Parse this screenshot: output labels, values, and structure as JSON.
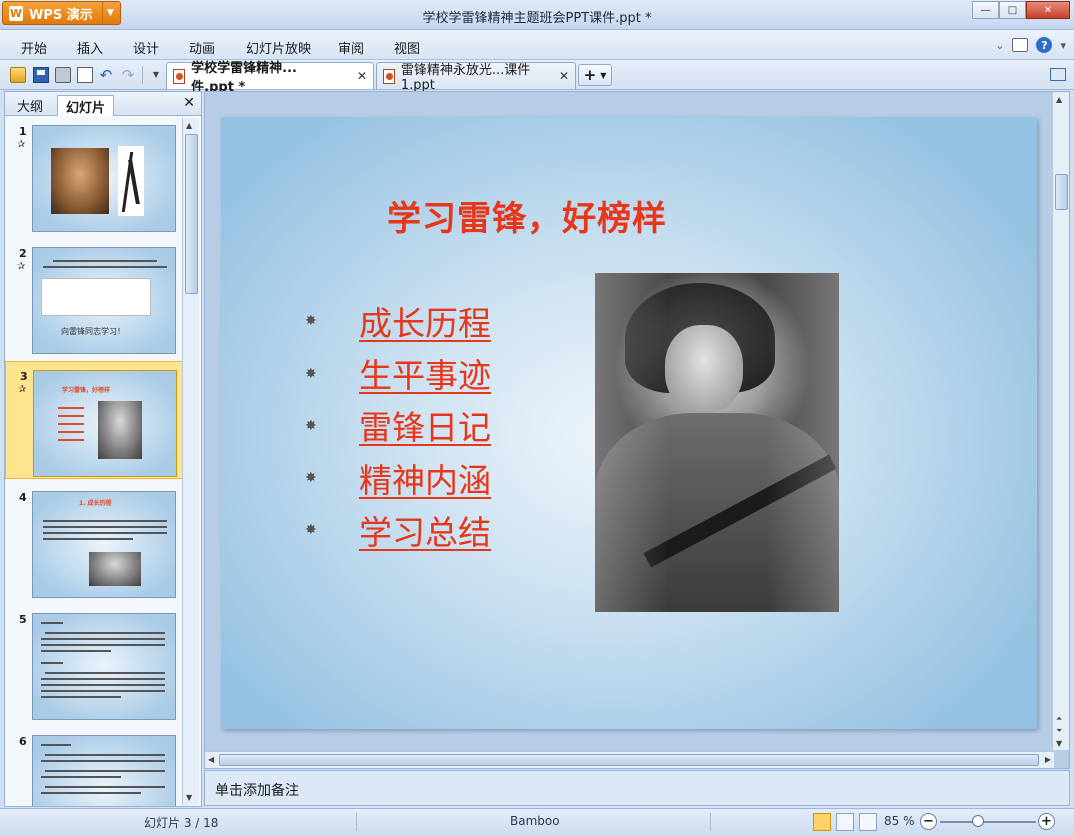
{
  "window": {
    "app_button_label": "WPS 演示",
    "app_logo_glyph": "W",
    "title": "学校学雷锋精神主题班会PPT课件.ppt *",
    "controls": [
      "—",
      "□",
      "✕"
    ]
  },
  "menu": {
    "items": [
      "开始",
      "插入",
      "设计",
      "动画",
      "幻灯片放映",
      "审阅",
      "视图"
    ]
  },
  "doc_tabs": [
    {
      "label": "学校学雷锋精神...件.ppt *",
      "active": true
    },
    {
      "label": "雷锋精神永放光...课件1.ppt",
      "active": false
    }
  ],
  "left_panel": {
    "tabs": [
      "大纲",
      "幻灯片"
    ],
    "active_tab": "幻灯片",
    "close": "✕",
    "thumbnails": [
      {
        "num": "1"
      },
      {
        "num": "2",
        "caption": "向雷锋同志学习！"
      },
      {
        "num": "3",
        "caption": "学习雷锋，好榜样",
        "selected": true
      },
      {
        "num": "4",
        "caption": "1. 成长历程"
      },
      {
        "num": "5"
      },
      {
        "num": "6"
      }
    ]
  },
  "slide": {
    "title": "学习雷锋，好榜样",
    "bullet_glyph": "✸",
    "items": [
      "成长历程",
      "生平事迹",
      "雷锋日记",
      "精神内涵",
      "学习总结"
    ]
  },
  "notes": {
    "placeholder": "单击添加备注"
  },
  "status": {
    "slide_indicator": "幻灯片 3 / 18",
    "theme": "Bamboo",
    "zoom": "85 %",
    "zoom_minus": "−",
    "zoom_plus": "+"
  }
}
